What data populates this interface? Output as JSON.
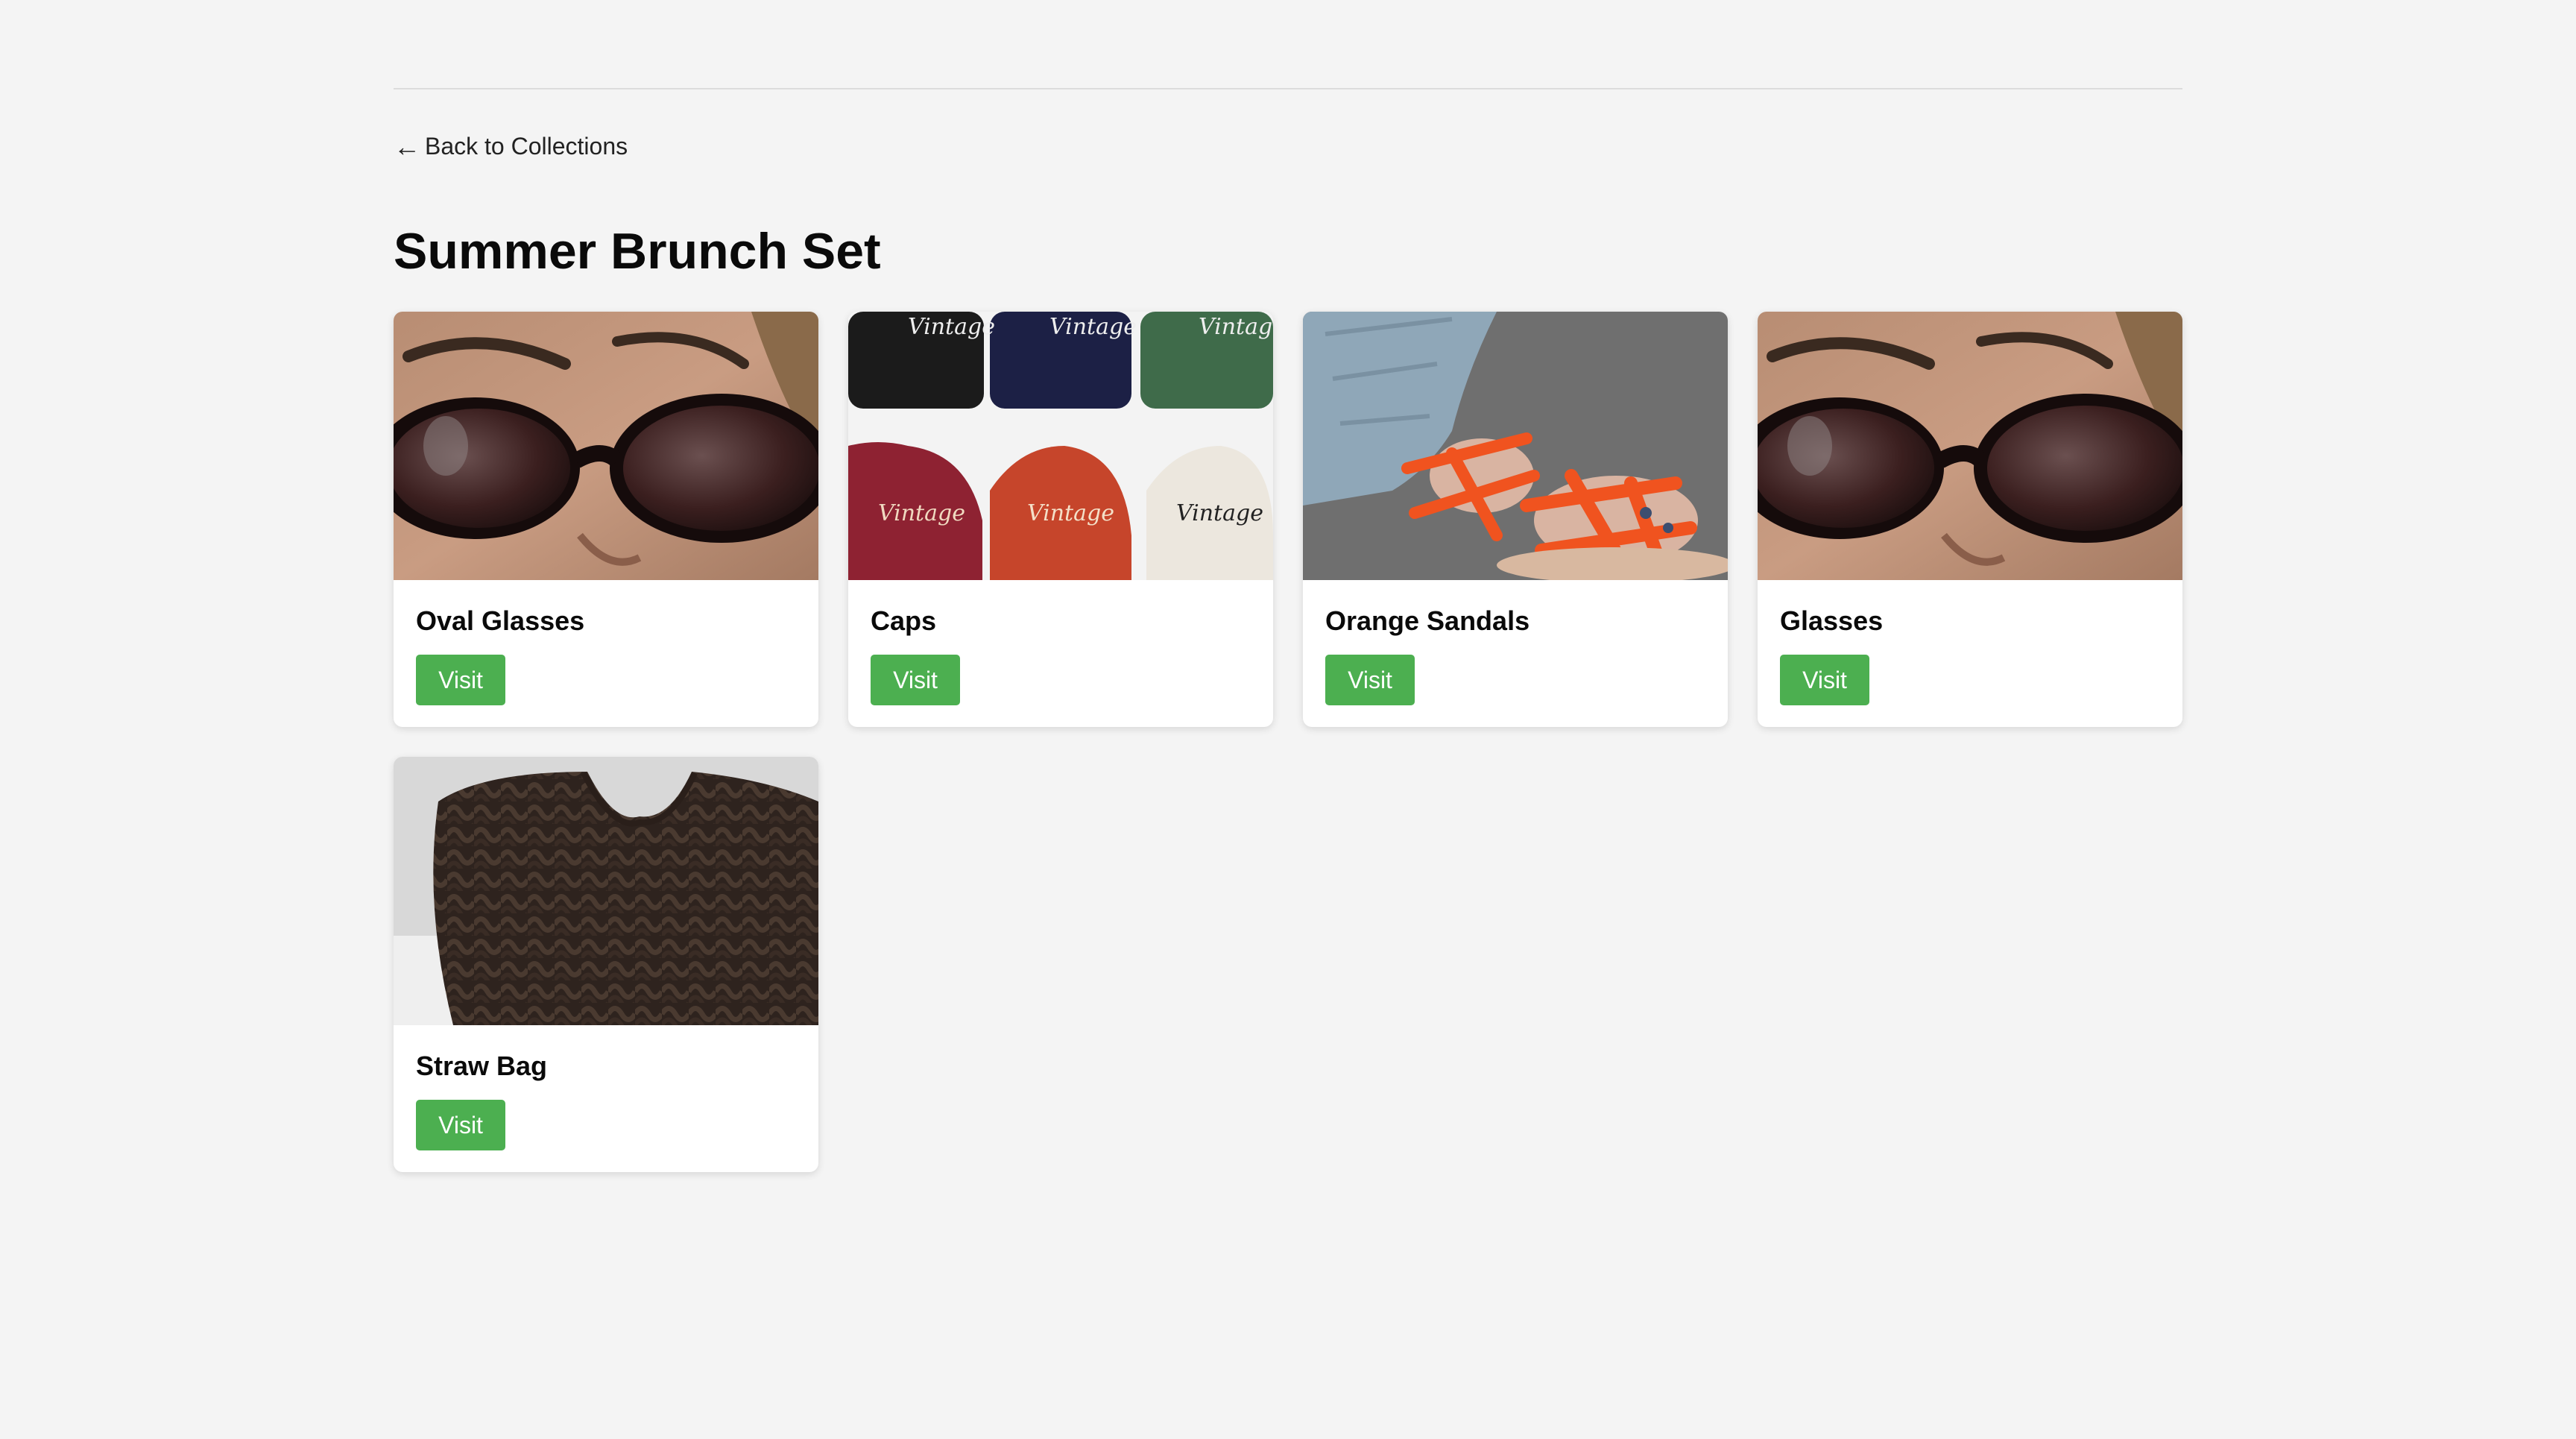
{
  "nav": {
    "back_arrow": "←",
    "back_label": "Back to Collections"
  },
  "collection": {
    "title": "Summer Brunch Set"
  },
  "items": [
    {
      "name": "Oval Glasses",
      "button": "Visit",
      "image": "oval-sunglasses-photo"
    },
    {
      "name": "Caps",
      "button": "Visit",
      "image": "vintage-caps-photo"
    },
    {
      "name": "Orange Sandals",
      "button": "Visit",
      "image": "orange-rope-sandals-photo"
    },
    {
      "name": "Glasses",
      "button": "Visit",
      "image": "oval-sunglasses-photo"
    },
    {
      "name": "Straw Bag",
      "button": "Visit",
      "image": "woven-straw-bag-photo"
    }
  ],
  "colors": {
    "background": "#f4f4f4",
    "card": "#ffffff",
    "visit_button": "#4caf50"
  }
}
